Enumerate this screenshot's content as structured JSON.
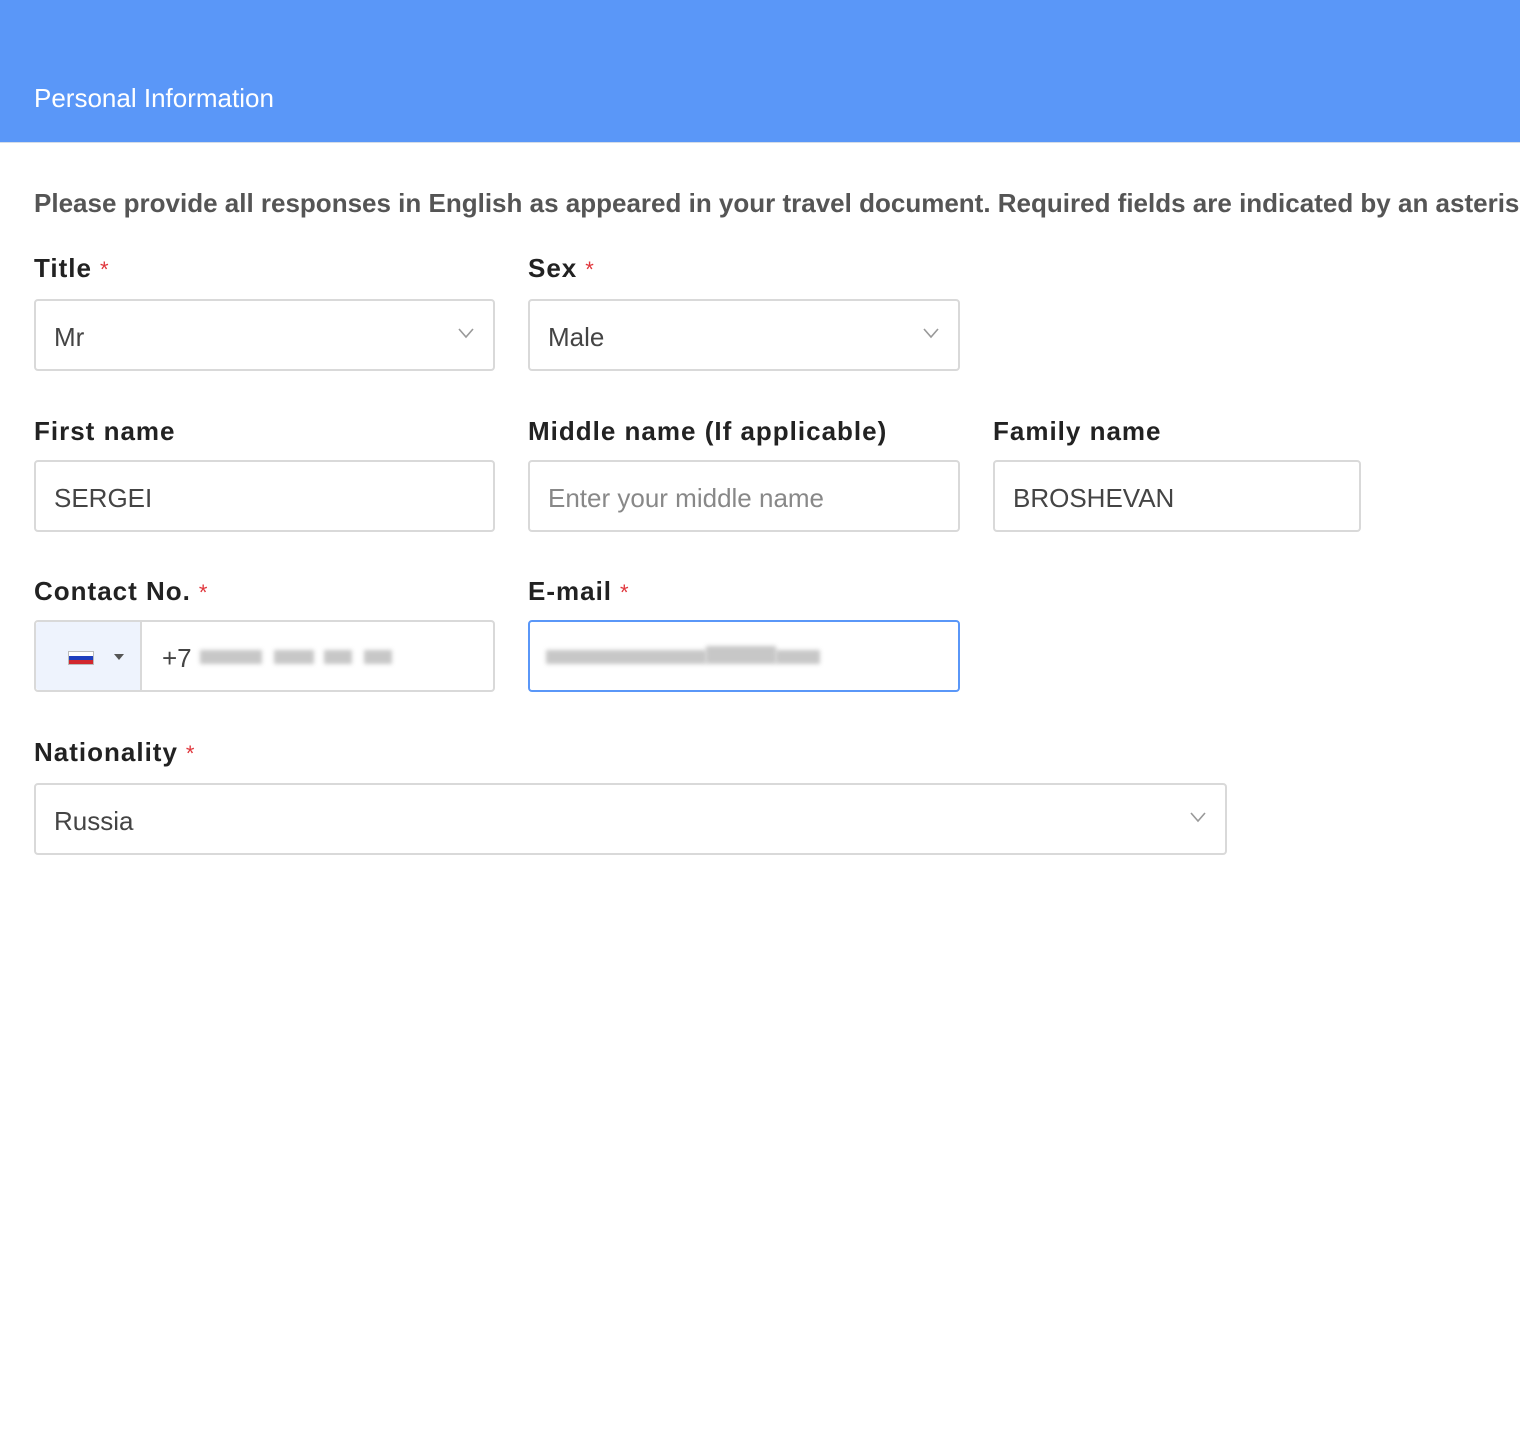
{
  "header": {
    "title": "Personal Information"
  },
  "intro": {
    "text": "Please provide all responses in English as appeared in your travel document. Required fields are indicated by an asterisk.",
    "required_mark": "*"
  },
  "form": {
    "title": {
      "label": "Title",
      "required_mark": "*",
      "value": "Mr"
    },
    "sex": {
      "label": "Sex",
      "required_mark": "*",
      "value": "Male"
    },
    "first_name": {
      "label": "First name",
      "value": "SERGEI"
    },
    "middle_name": {
      "label": "Middle name (If applicable)",
      "placeholder": "Enter your middle name",
      "value": ""
    },
    "family_name": {
      "label": "Family name",
      "value": "BROSHEVAN"
    },
    "contact": {
      "label": "Contact No.",
      "required_mark": "*",
      "dial_code": "+7",
      "country_flag": "russia-flag"
    },
    "email": {
      "label": "E-mail",
      "required_mark": "*"
    },
    "nationality": {
      "label": "Nationality",
      "required_mark": "*",
      "value": "Russia"
    }
  },
  "colors": {
    "header_bg": "#5a97f8",
    "required": "#e0363c",
    "focus_border": "#5a97f8",
    "field_border": "#d9d9d9"
  }
}
